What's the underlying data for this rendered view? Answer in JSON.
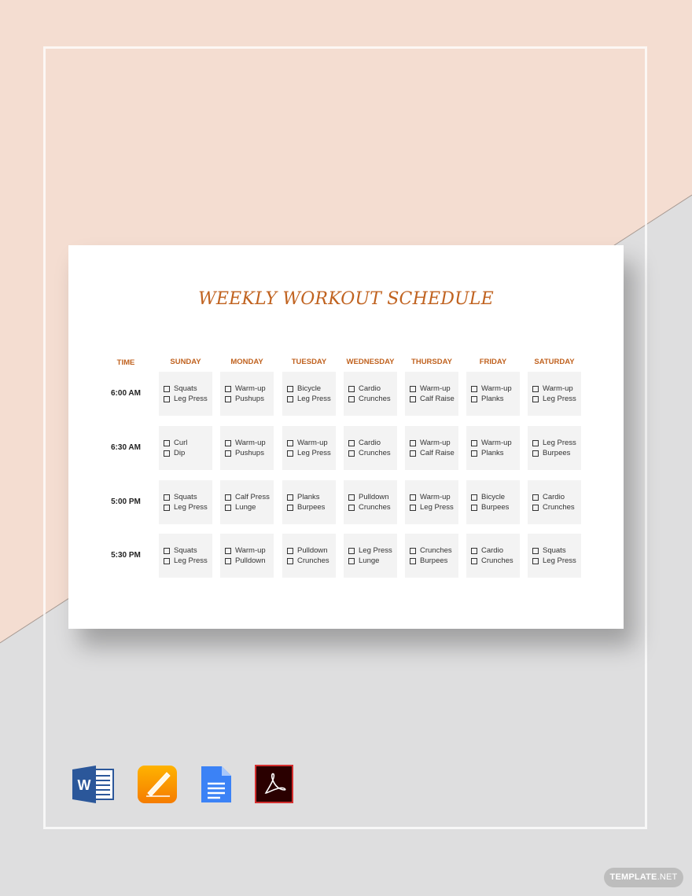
{
  "document": {
    "title": "WEEKLY WORKOUT SCHEDULE",
    "time_header": "TIME",
    "days": [
      "SUNDAY",
      "MONDAY",
      "TUESDAY",
      "WEDNESDAY",
      "THURSDAY",
      "FRIDAY",
      "SATURDAY"
    ],
    "rows": [
      {
        "time": "6:00 AM",
        "cells": [
          [
            "Squats",
            "Leg Press"
          ],
          [
            "Warm-up",
            "Pushups"
          ],
          [
            "Bicycle",
            "Leg Press"
          ],
          [
            "Cardio",
            "Crunches"
          ],
          [
            "Warm-up",
            "Calf Raise"
          ],
          [
            "Warm-up",
            "Planks"
          ],
          [
            "Warm-up",
            "Leg Press"
          ]
        ]
      },
      {
        "time": "6:30 AM",
        "cells": [
          [
            "Curl",
            "Dip"
          ],
          [
            "Warm-up",
            "Pushups"
          ],
          [
            "Warm-up",
            "Leg Press"
          ],
          [
            "Cardio",
            "Crunches"
          ],
          [
            "Warm-up",
            "Calf Raise"
          ],
          [
            "Warm-up",
            "Planks"
          ],
          [
            "Leg Press",
            "Burpees"
          ]
        ]
      },
      {
        "time": "5:00 PM",
        "cells": [
          [
            "Squats",
            "Leg Press"
          ],
          [
            "Calf Press",
            "Lunge"
          ],
          [
            "Planks",
            "Burpees"
          ],
          [
            "Pulldown",
            "Crunches"
          ],
          [
            "Warm-up",
            "Leg Press"
          ],
          [
            "Bicycle",
            "Burpees"
          ],
          [
            "Cardio",
            "Crunches"
          ]
        ]
      },
      {
        "time": "5:30 PM",
        "cells": [
          [
            "Squats",
            "Leg Press"
          ],
          [
            "Warm-up",
            "Pulldown"
          ],
          [
            "Pulldown",
            "Crunches"
          ],
          [
            "Leg Press",
            "Lunge"
          ],
          [
            "Crunches",
            "Burpees"
          ],
          [
            "Cardio",
            "Crunches"
          ],
          [
            "Squats",
            "Leg Press"
          ]
        ]
      }
    ]
  },
  "format_icons": [
    {
      "name": "word-icon",
      "label": "W"
    },
    {
      "name": "pages-icon",
      "label": ""
    },
    {
      "name": "google-docs-icon",
      "label": ""
    },
    {
      "name": "adobe-pdf-icon",
      "label": ""
    }
  ],
  "badge": {
    "bold": "TEMPLATE",
    "thin": ".NET"
  },
  "colors": {
    "accent": "#c0621f",
    "peach": "#f4ddd1",
    "gray": "#dededf",
    "cell": "#f3f3f3"
  }
}
